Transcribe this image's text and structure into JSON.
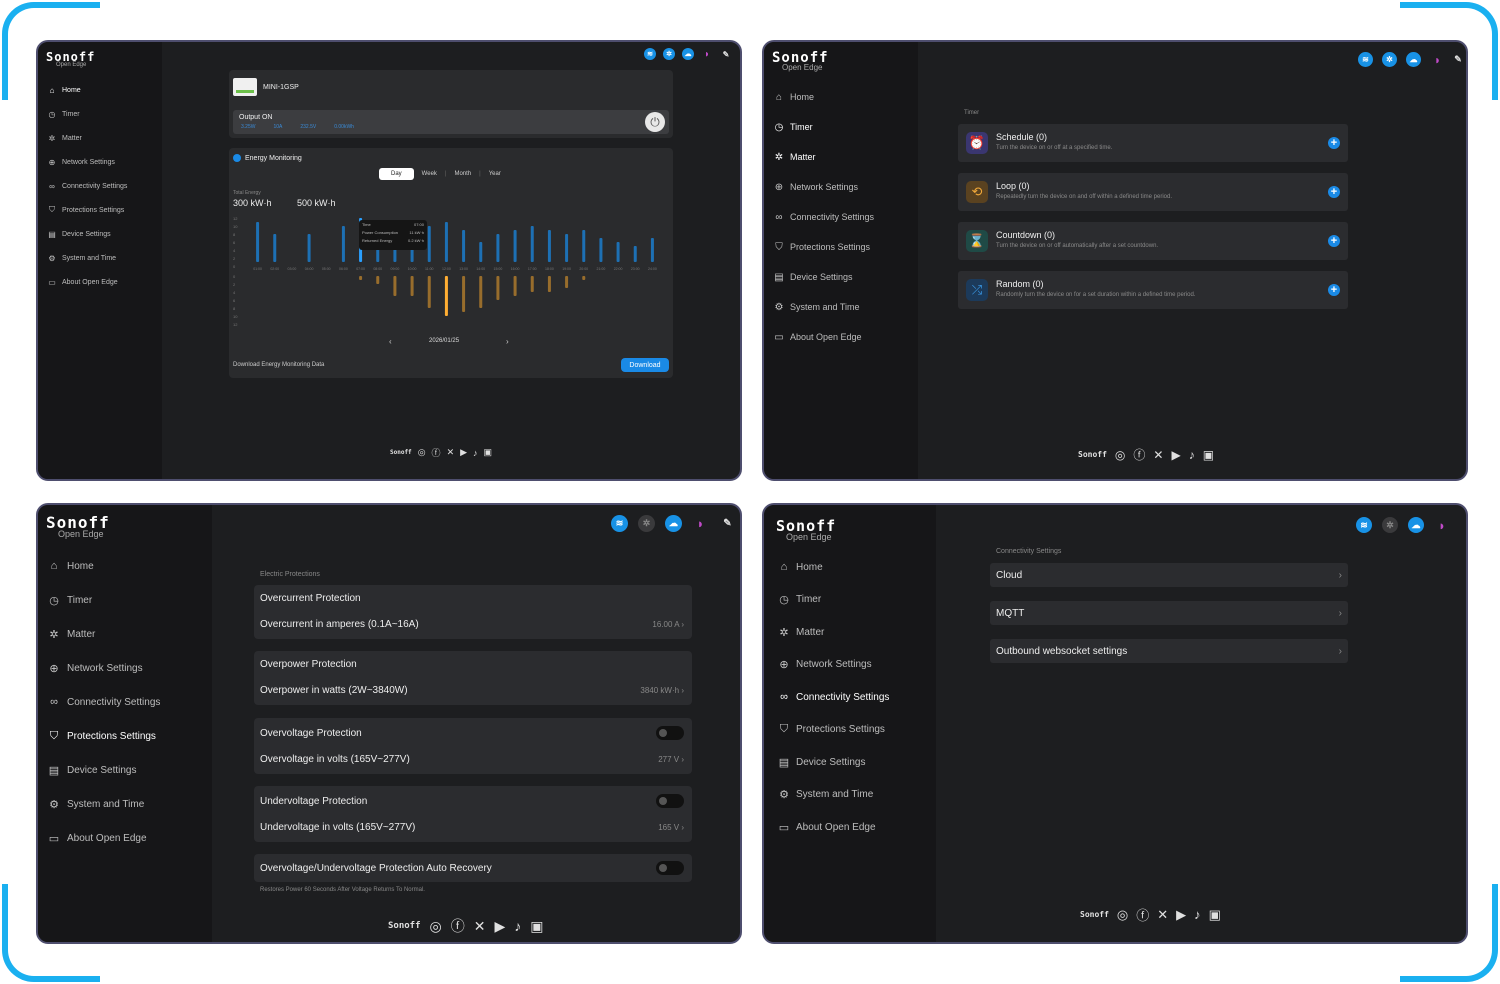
{
  "brand": {
    "name": "Sonoff",
    "sub": "Open Edge"
  },
  "nav": [
    {
      "label": "Home",
      "icon": "home-icon"
    },
    {
      "label": "Timer",
      "icon": "timer-icon"
    },
    {
      "label": "Matter",
      "icon": "matter-icon"
    },
    {
      "label": "Network Settings",
      "icon": "globe-icon"
    },
    {
      "label": "Connectivity Settings",
      "icon": "link-icon"
    },
    {
      "label": "Protections Settings",
      "icon": "shield-icon"
    },
    {
      "label": "Device Settings",
      "icon": "device-icon"
    },
    {
      "label": "System and Time",
      "icon": "gear-icon"
    },
    {
      "label": "About Open Edge",
      "icon": "info-icon"
    }
  ],
  "footer": {
    "logo": "Sonoff"
  },
  "home": {
    "device_name": "MINI-1GSP",
    "output_label": "Output ON",
    "output_stats": [
      "3.25W",
      "10A",
      "232.5V",
      "0.00kWh"
    ],
    "energy_title": "Energy Monitoring",
    "tabs": [
      "Day",
      "Week",
      "Month",
      "Year"
    ],
    "total_label": "Total Energy",
    "total_consumed": "300 kW·h",
    "total_produced": "500 kW·h",
    "tooltip": {
      "time_label": "Time",
      "time": "07:00",
      "consumed_label": "Power Consumption",
      "consumed": "11 kW·h",
      "returned_label": "Returned Energy",
      "returned": "0.2 kW·h"
    },
    "date": "2026/01/25",
    "download_label": "Download Energy Monitoring Data",
    "download_button": "Download"
  },
  "chart_data": {
    "type": "bar",
    "categories": [
      "01:00",
      "02:00",
      "03:00",
      "04:00",
      "05:00",
      "06:00",
      "07:00",
      "08:00",
      "09:00",
      "10:00",
      "11:00",
      "12:00",
      "13:00",
      "14:00",
      "15:00",
      "16:00",
      "17:00",
      "18:00",
      "19:00",
      "20:00",
      "21:00",
      "22:00",
      "23:00",
      "24:00"
    ],
    "y_ticks_top": [
      "12",
      "10",
      "8",
      "6",
      "4",
      "2",
      "0"
    ],
    "y_ticks_bottom": [
      "0",
      "2",
      "4",
      "6",
      "8",
      "10",
      "12"
    ],
    "series": [
      {
        "values": [
          10,
          7,
          0,
          7,
          0,
          9,
          11,
          9,
          8,
          8,
          9,
          10,
          8,
          5,
          7,
          8,
          9,
          8,
          7,
          8,
          6,
          5,
          4,
          6
        ],
        "color": "#1a82d6"
      },
      {
        "values": [
          0,
          0,
          0,
          0,
          0,
          0,
          1,
          2,
          5,
          5,
          8,
          10,
          9,
          8,
          6,
          5,
          4,
          4,
          3,
          1,
          0,
          0,
          0,
          0
        ],
        "color": "#f3a42c"
      }
    ],
    "highlight_index": 6,
    "ylim": [
      0,
      12
    ]
  },
  "timer": {
    "section": "Timer",
    "items": [
      {
        "title": "Schedule (0)",
        "desc": "Turn the device on or off at a specified time.",
        "icon": "alarm-icon",
        "color": "#7a6be6",
        "bg": "#3a3670"
      },
      {
        "title": "Loop (0)",
        "desc": "Repeatedly turn the device on and off within a defined time period.",
        "icon": "loop-icon",
        "color": "#f0a83a",
        "bg": "#5a4220"
      },
      {
        "title": "Countdown (0)",
        "desc": "Turn the device on or off automatically after a set countdown.",
        "icon": "hourglass-icon",
        "color": "#3ab8a8",
        "bg": "#1f4a46"
      },
      {
        "title": "Random (0)",
        "desc": "Randomly turn the device on for a set duration within a defined time period.",
        "icon": "shuffle-icon",
        "color": "#3a98e6",
        "bg": "#1c3a5a"
      }
    ]
  },
  "protections": {
    "section": "Electric Protections",
    "cards": [
      {
        "title": "Overcurrent Protection",
        "detail": "Overcurrent in amperes (0.1A~16A)",
        "value": "16.00 A"
      },
      {
        "title": "Overpower Protection",
        "detail": "Overpower in watts (2W~3840W)",
        "value": "3840 kW·h"
      },
      {
        "title": "Overvoltage Protection",
        "detail": "Overvoltage in volts (165V~277V)",
        "value": "277 V"
      },
      {
        "title": "Undervoltage Protection",
        "detail": "Undervoltage in volts (165V~277V)",
        "value": "165 V"
      }
    ],
    "auto_recovery": "Overvoltage/Undervoltage Protection Auto Recovery",
    "auto_recovery_note": "Restores Power 60 Seconds After Voltage Returns To Normal."
  },
  "connectivity": {
    "section": "Connectivity Settings",
    "items": [
      "Cloud",
      "MQTT",
      "Outbound websocket settings"
    ]
  }
}
